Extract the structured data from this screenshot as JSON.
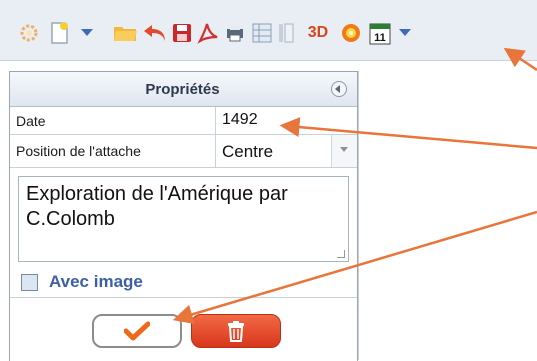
{
  "toolbar": {
    "items": [
      {
        "name": "settings-icon",
        "color": "#f0b060"
      },
      {
        "name": "new-document-icon",
        "color": "#f2cf3a"
      },
      {
        "name": "dropdown-icon",
        "color": "#3f6bb5"
      },
      {
        "name": "open-folder-icon",
        "color": "#f5b63a"
      },
      {
        "name": "undo-icon",
        "color": "#e04b2d"
      },
      {
        "name": "save-icon",
        "color": "#c9282d"
      },
      {
        "name": "pdf-icon",
        "color": "#d32f2f"
      },
      {
        "name": "print-icon",
        "color": "#5a6a7a"
      },
      {
        "name": "grid-icon",
        "color": "#8aa0b8"
      },
      {
        "name": "column-icon",
        "color": "#a8b4c2"
      },
      {
        "name": "3d-label",
        "color": "#d9451a"
      },
      {
        "name": "globe-icon",
        "color": "#f07a1a"
      },
      {
        "name": "calendar-icon",
        "color": "#2e7d32"
      },
      {
        "name": "more-dropdown-icon",
        "color": "#3f6bb5"
      }
    ],
    "label_3d": "3D",
    "calendar_day": "11"
  },
  "panel": {
    "title": "Propriétés",
    "date_label": "Date",
    "date_value": "1492",
    "position_label": "Position de l'attache",
    "position_value": "Centre",
    "description": "Exploration de l'Amérique par C.Colomb",
    "image_checkbox_label": "Avec image",
    "image_checked": false
  },
  "colors": {
    "accent": "#3c5fa8",
    "delete": "#e1431f",
    "ok_check": "#ee6a1a",
    "arrow": "#e8753a"
  }
}
